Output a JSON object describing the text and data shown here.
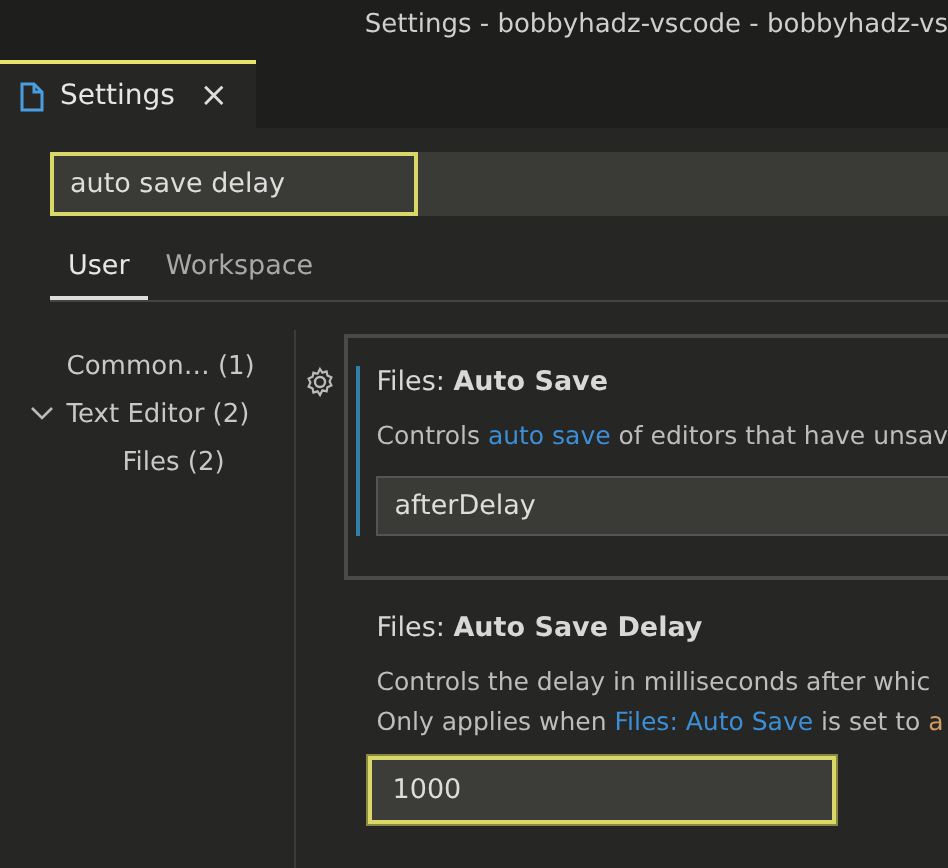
{
  "window": {
    "title": "Settings - bobbyhadz-vscode - bobbyhadz-vs"
  },
  "editor_tabs": [
    {
      "label": "Settings",
      "selected": true,
      "close": "×"
    }
  ],
  "search": {
    "value": "auto save delay",
    "highlighted": true
  },
  "scope_tabs": [
    {
      "label": "User",
      "selected": true
    },
    {
      "label": "Workspace",
      "selected": false
    }
  ],
  "toc": [
    {
      "label": "Common… (1)",
      "expanded": false
    },
    {
      "label": "Text Editor (2)",
      "expanded": true,
      "children": [
        {
          "label": "Files (2)",
          "expanded": false
        }
      ]
    }
  ],
  "settings": [
    {
      "category": "Files: ",
      "name": "Auto Save",
      "focused": true,
      "kind": "select",
      "value": "afterDelay",
      "description": [
        [
          {
            "kind": "text",
            "text": "Controls "
          },
          {
            "kind": "link",
            "text": "auto save"
          },
          {
            "kind": "text",
            "text": " of editors that have unsav"
          }
        ]
      ]
    },
    {
      "category": "Files: ",
      "name": "Auto Save Delay",
      "focused": false,
      "kind": "number",
      "value": "1000",
      "highlighted": true,
      "description": [
        [
          {
            "kind": "text",
            "text": "Controls the delay in milliseconds after whic"
          }
        ],
        [
          {
            "kind": "text",
            "text": "Only applies when "
          },
          {
            "kind": "link",
            "text": "Files: Auto Save"
          },
          {
            "kind": "text",
            "text": " is set to "
          },
          {
            "kind": "code",
            "text": "a"
          }
        ]
      ]
    }
  ]
}
